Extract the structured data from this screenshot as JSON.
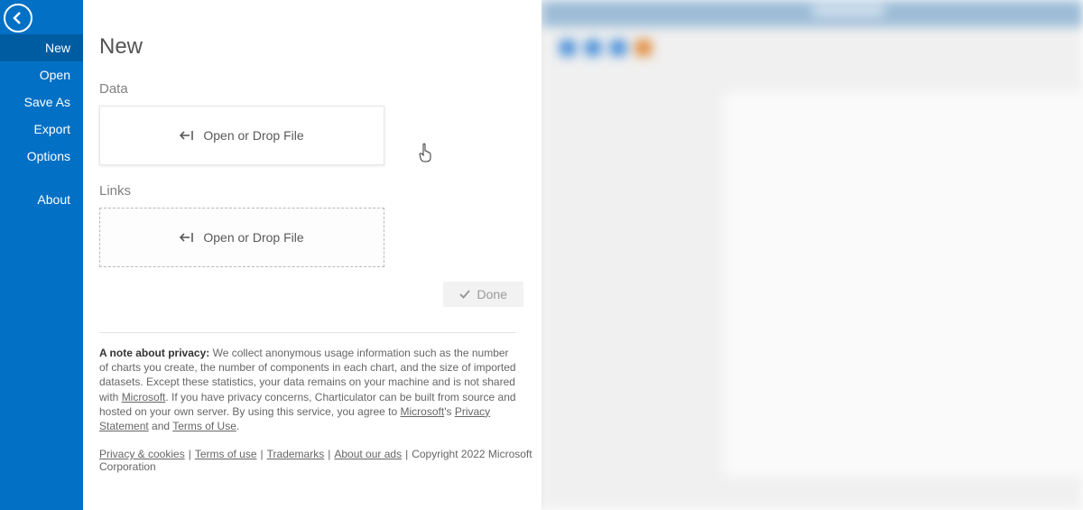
{
  "sidebar": {
    "items": [
      {
        "label": "New",
        "selected": true
      },
      {
        "label": "Open"
      },
      {
        "label": "Save As"
      },
      {
        "label": "Export"
      },
      {
        "label": "Options"
      }
    ],
    "secondary": [
      {
        "label": "About"
      }
    ]
  },
  "page": {
    "title": "New",
    "sections": {
      "data": {
        "label": "Data",
        "drop_label": "Open or Drop File"
      },
      "links": {
        "label": "Links",
        "drop_label": "Open or Drop File"
      }
    },
    "done_label": "Done"
  },
  "privacy": {
    "heading": "A note about privacy:",
    "body_1": " We collect anonymous usage information such as the number of charts you create, the number of components in each chart, and the size of imported datasets. Except these statistics, your data remains on your machine and is not shared with ",
    "link_ms": "Microsoft",
    "body_2": ". If you have privacy concerns, Charticulator can be built from source and hosted on your own server. By using this service, you agree to ",
    "link_ms2": "Microsoft",
    "possessive": "'s ",
    "link_ps": "Privacy Statement",
    "and": " and ",
    "link_tou": "Terms of Use",
    "period": "."
  },
  "footer": {
    "links": [
      "Privacy & cookies",
      "Terms of use",
      "Trademarks",
      "About our ads"
    ],
    "copyright": "Copyright 2022 Microsoft Corporation"
  }
}
